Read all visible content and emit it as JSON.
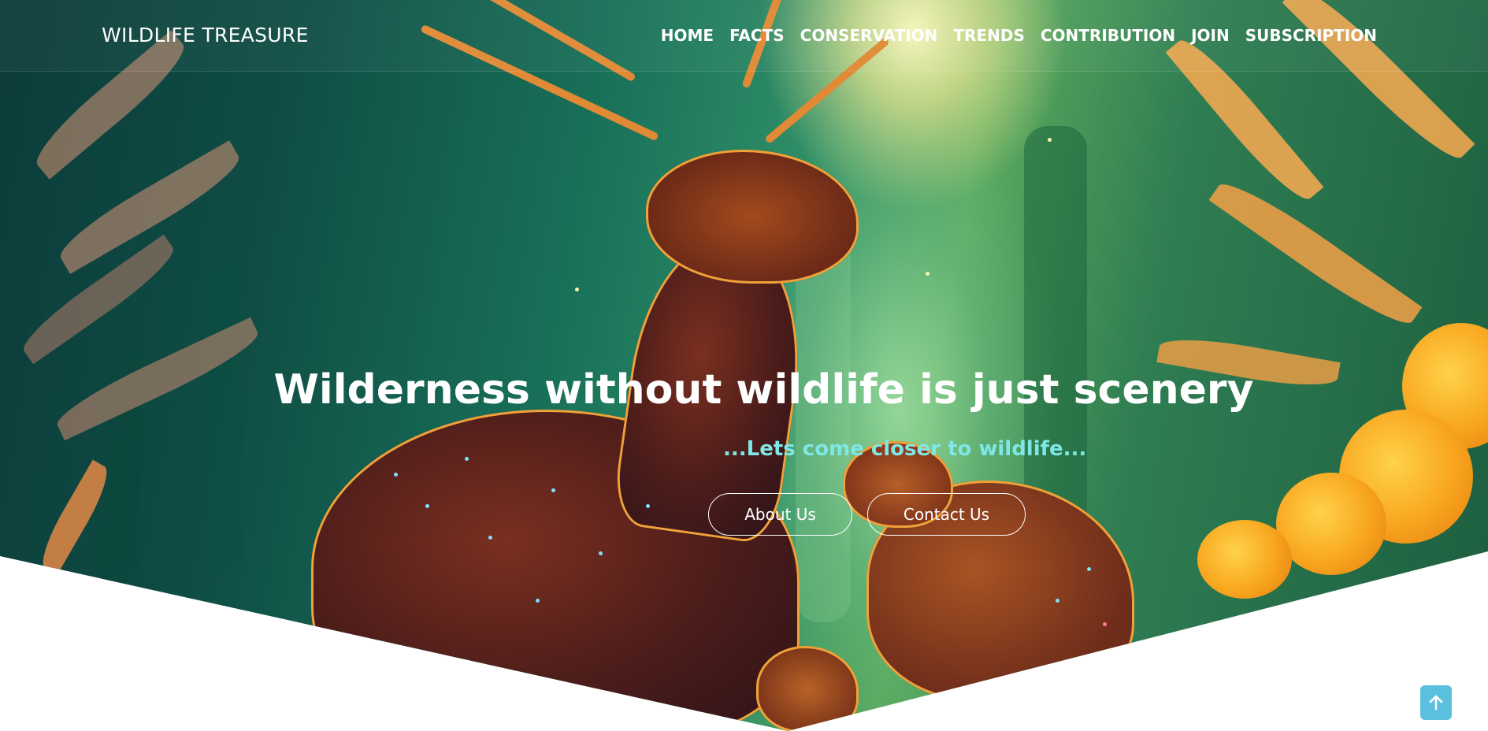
{
  "brand": {
    "name": "WILDLIFE TREASURE"
  },
  "nav": {
    "items": [
      {
        "label": "HOME"
      },
      {
        "label": "FACTS"
      },
      {
        "label": "CONSERVATION"
      },
      {
        "label": "TRENDS"
      },
      {
        "label": "CONTRIBUTION"
      },
      {
        "label": "JOIN"
      },
      {
        "label": "SUBSCRIPTION"
      }
    ]
  },
  "hero": {
    "title": "Wilderness without wildlife is just scenery",
    "subtitle": "...Lets come closer to wildlife...",
    "buttons": {
      "about": "About Us",
      "contact": "Contact Us"
    }
  },
  "back_to_top": {
    "icon": "arrow-up-icon"
  },
  "colors": {
    "subtitle": "#7fe7e6",
    "back_to_top": "#5bc0de",
    "text": "#ffffff"
  }
}
